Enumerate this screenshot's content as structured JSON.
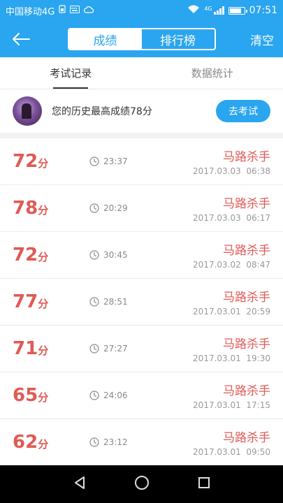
{
  "status": {
    "carrier": "中国移动4G",
    "time": "07:51",
    "battery_level": 0.85,
    "icons": [
      "sim-icon",
      "keyboard-icon",
      "cloud-icon",
      "wifi-icon",
      "4g-signal-icon",
      "battery-icon"
    ],
    "network_badge": "4G"
  },
  "header": {
    "back_icon": "arrow-left-icon",
    "segments": [
      {
        "label": "成绩",
        "active": true
      },
      {
        "label": "排行榜",
        "active": false
      }
    ],
    "clear_label": "清空"
  },
  "tabs": [
    {
      "label": "考试记录",
      "active": true
    },
    {
      "label": "数据统计",
      "active": false
    }
  ],
  "best": {
    "text": "您的历史最高成绩78分",
    "button_label": "去考试"
  },
  "records": [
    {
      "score": "72",
      "unit": "分",
      "duration": "23:37",
      "name": "马路杀手",
      "date": "2017.03.03",
      "time": "06:38"
    },
    {
      "score": "78",
      "unit": "分",
      "duration": "20:29",
      "name": "马路杀手",
      "date": "2017.03.03",
      "time": "06:17"
    },
    {
      "score": "72",
      "unit": "分",
      "duration": "30:45",
      "name": "马路杀手",
      "date": "2017.03.02",
      "time": "08:47"
    },
    {
      "score": "77",
      "unit": "分",
      "duration": "28:51",
      "name": "马路杀手",
      "date": "2017.03.01",
      "time": "20:59"
    },
    {
      "score": "71",
      "unit": "分",
      "duration": "27:27",
      "name": "马路杀手",
      "date": "2017.03.01",
      "time": "19:30"
    },
    {
      "score": "65",
      "unit": "分",
      "duration": "24:06",
      "name": "马路杀手",
      "date": "2017.03.01",
      "time": "17:15"
    },
    {
      "score": "62",
      "unit": "分",
      "duration": "23:12",
      "name": "马路杀手",
      "date": "2017.03.01",
      "time": "09:50"
    }
  ],
  "nav": {
    "icons": [
      "back-triangle-icon",
      "home-circle-icon",
      "recents-square-icon"
    ]
  },
  "colors": {
    "accent": "#2aa5ef",
    "score_red": "#e05a55"
  }
}
